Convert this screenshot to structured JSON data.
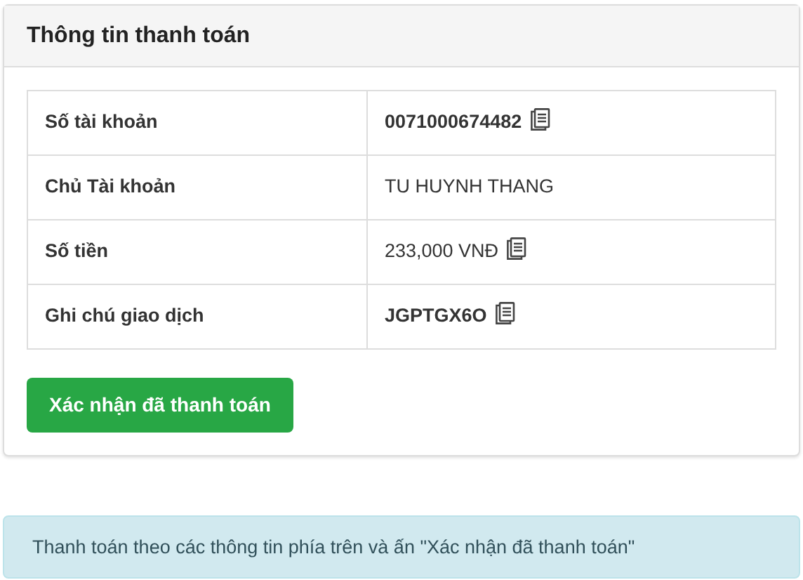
{
  "card": {
    "title": "Thông tin thanh toán",
    "rows": [
      {
        "label": "Số tài khoản",
        "value": "0071000674482",
        "bold": true,
        "copyable": true
      },
      {
        "label": "Chủ Tài khoản",
        "value": "TU HUYNH THANG",
        "bold": false,
        "copyable": false
      },
      {
        "label": "Số tiền",
        "value": "233,000 VNĐ",
        "bold": false,
        "copyable": true
      },
      {
        "label": "Ghi chú giao dịch",
        "value": "JGPTGX6O",
        "bold": true,
        "copyable": true
      }
    ],
    "button": "Xác nhận đã thanh toán"
  },
  "alert": "Thanh toán theo các thông tin phía trên và ấn \"Xác nhận đã thanh toán\""
}
